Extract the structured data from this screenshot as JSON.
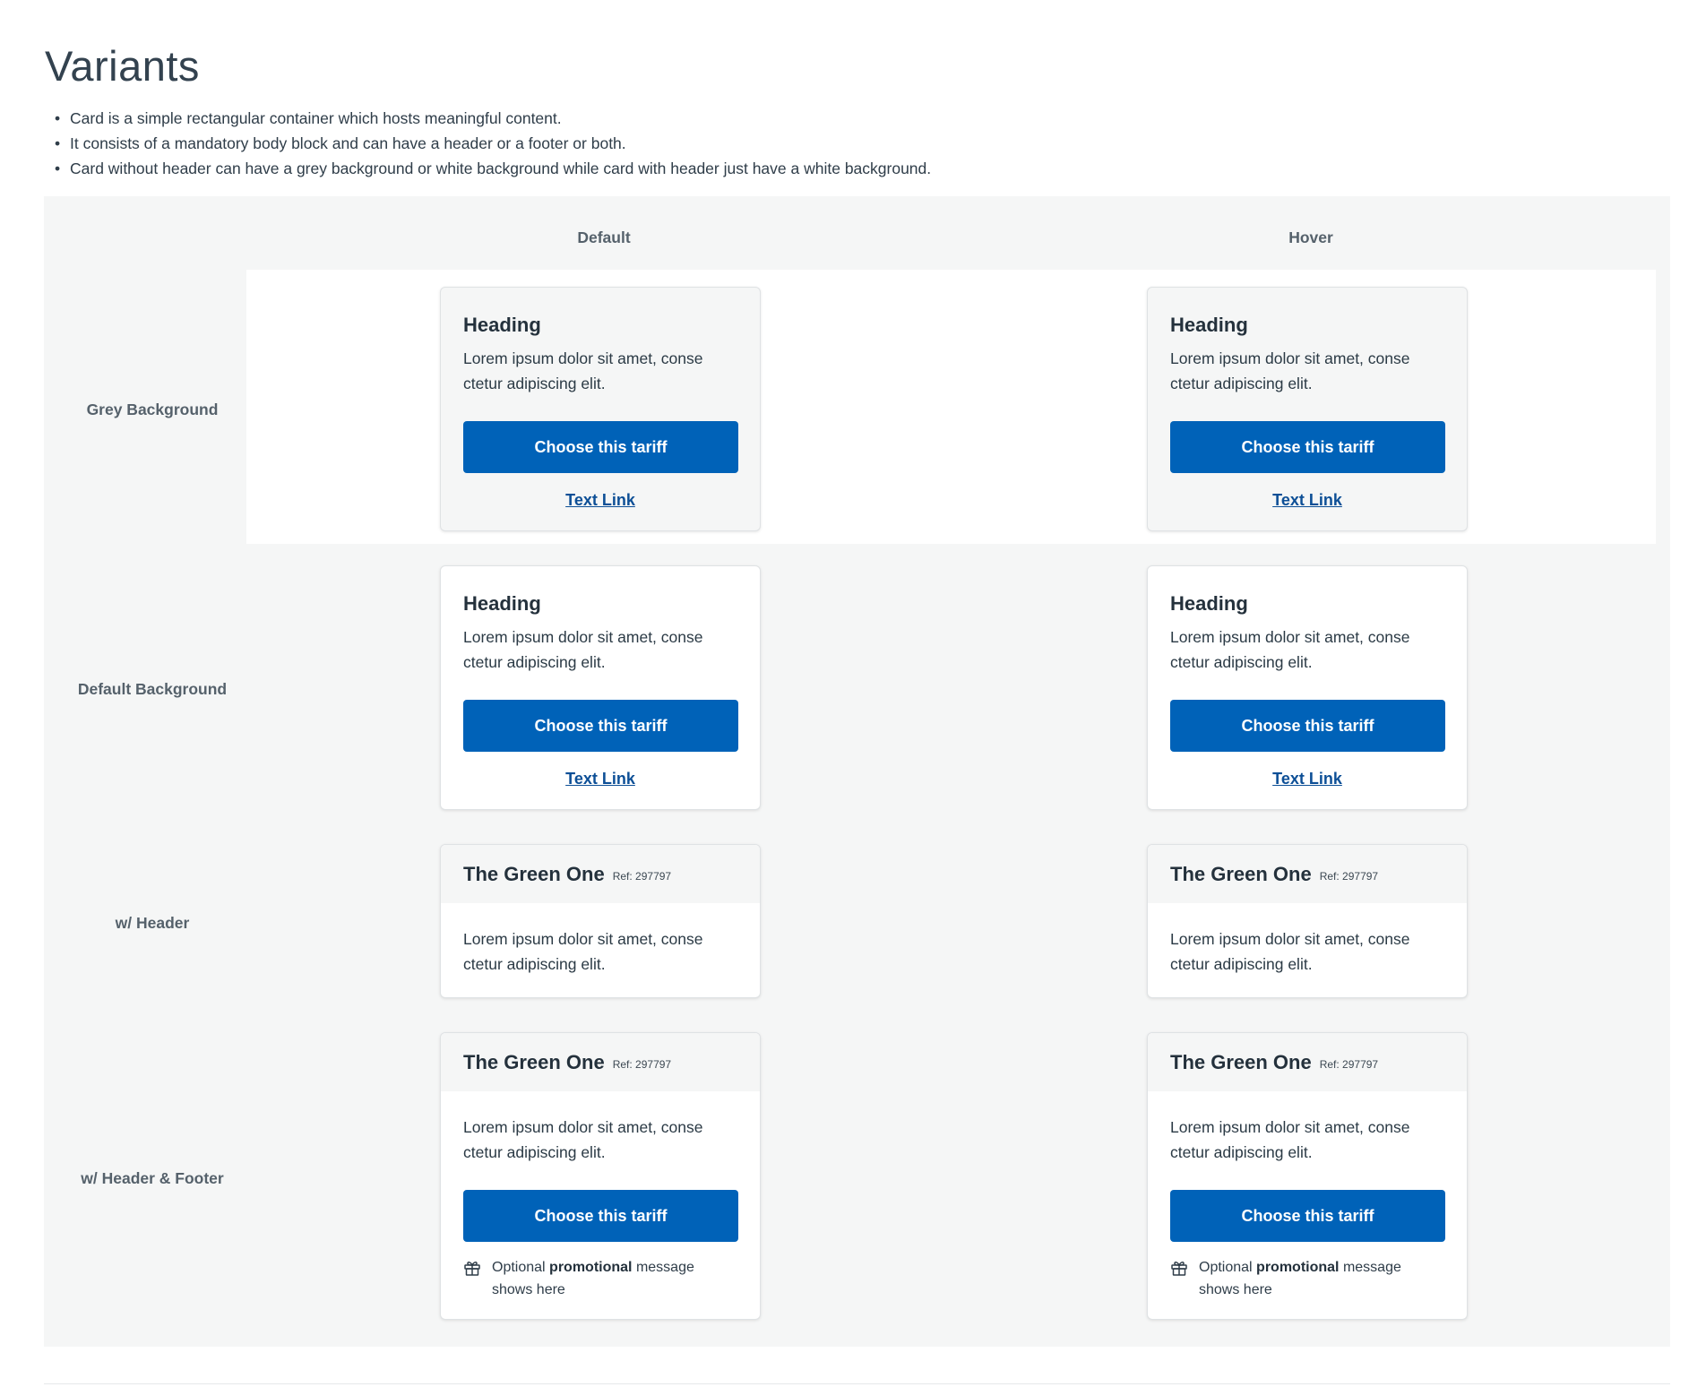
{
  "page": {
    "title": "Variants",
    "bullets": [
      "Card is a simple rectangular container which hosts meaningful content.",
      "It consists of a mandatory body block and can have a header or a footer or both.",
      "Card without header can have a grey background or white background while card with header just have a white background."
    ]
  },
  "columns": {
    "default": "Default",
    "hover": "Hover"
  },
  "rows": {
    "grey": "Grey Background",
    "default": "Default Background",
    "header": "w/ Header",
    "header_footer": "w/ Header & Footer"
  },
  "card": {
    "heading": "Heading",
    "body": "Lorem ipsum dolor sit amet, conse ctetur adipiscing elit.",
    "button": "Choose this tariff",
    "link": "Text Link",
    "header_title": "The Green One",
    "header_ref": "Ref: 297797",
    "promo_before": "Optional",
    "promo_bold": "promotional",
    "promo_after": "message shows here"
  },
  "colors": {
    "primary": "#0062b8",
    "link": "#0d4f96",
    "panel": "#f5f6f6"
  },
  "icons": {
    "promo": "gift-icon"
  }
}
